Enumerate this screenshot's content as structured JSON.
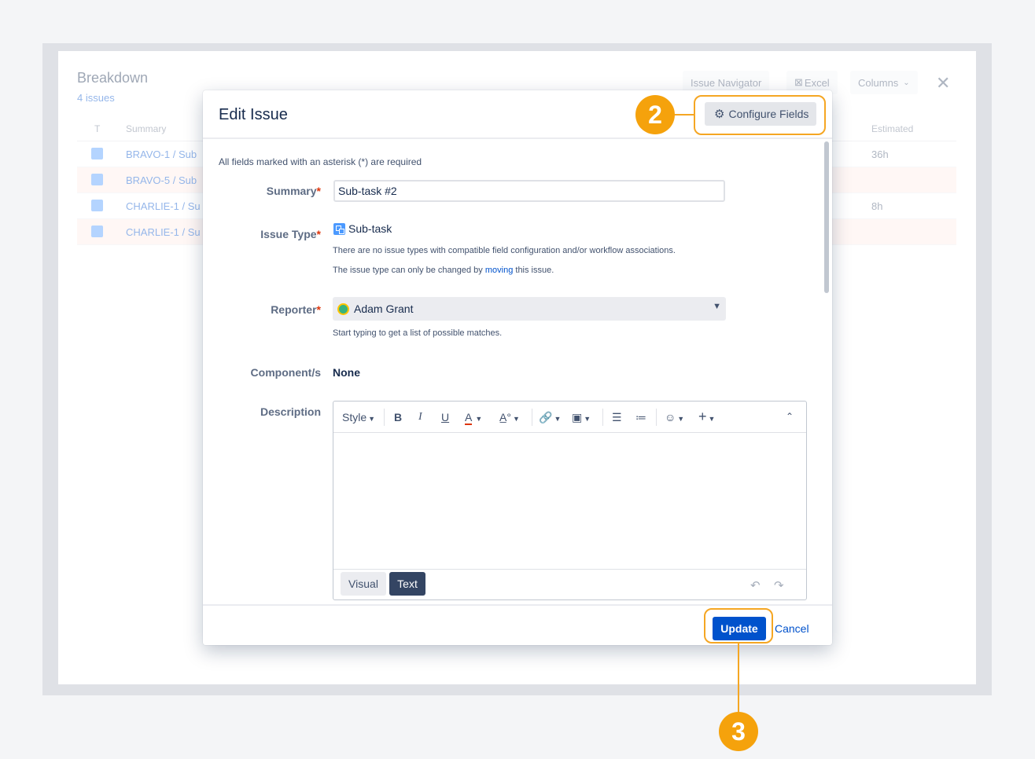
{
  "background": {
    "title": "Breakdown",
    "count": "4 issues",
    "buttons": {
      "navigator": "Issue Navigator",
      "excel": "Excel",
      "columns": "Columns"
    },
    "columns": {
      "type": "T",
      "summary": "Summary",
      "estimated": "Estimated"
    },
    "rows": [
      {
        "key": "BRAVO-1 /  Sub",
        "estimate": "36h"
      },
      {
        "key": "BRAVO-5 /  Sub",
        "estimate": ""
      },
      {
        "key": "CHARLIE-1 /  Su",
        "estimate": "8h"
      },
      {
        "key": "CHARLIE-1 /  Su",
        "estimate": ""
      }
    ]
  },
  "modal": {
    "title": "Edit Issue",
    "configure_fields": "Configure Fields",
    "required_note": "All fields marked with an asterisk (*) are required",
    "fields": {
      "summary_label": "Summary",
      "summary_value": "Sub-task #2",
      "issue_type_label": "Issue Type",
      "issue_type_value": "Sub-task",
      "issue_type_help1": "There are no issue types with compatible field configuration and/or workflow associations.",
      "issue_type_help2_pre": "The issue type can only be changed by ",
      "issue_type_help2_link": "moving",
      "issue_type_help2_post": " this issue.",
      "reporter_label": "Reporter",
      "reporter_value": "Adam Grant",
      "reporter_help": "Start typing to get a list of possible matches.",
      "component_label": "Component/s",
      "component_value": "None",
      "description_label": "Description",
      "required_mark": "*"
    },
    "editor": {
      "style_label": "Style",
      "bold": "B",
      "italic": "I",
      "underline": "U",
      "text_color": "A",
      "visual_tab": "Visual",
      "text_tab": "Text"
    },
    "update_label": "Update",
    "cancel_label": "Cancel"
  },
  "callouts": {
    "configure_step": "2",
    "update_step": "3"
  },
  "colors": {
    "accent": "#f5a20c",
    "primary": "#0052cc",
    "required": "#de350b"
  }
}
